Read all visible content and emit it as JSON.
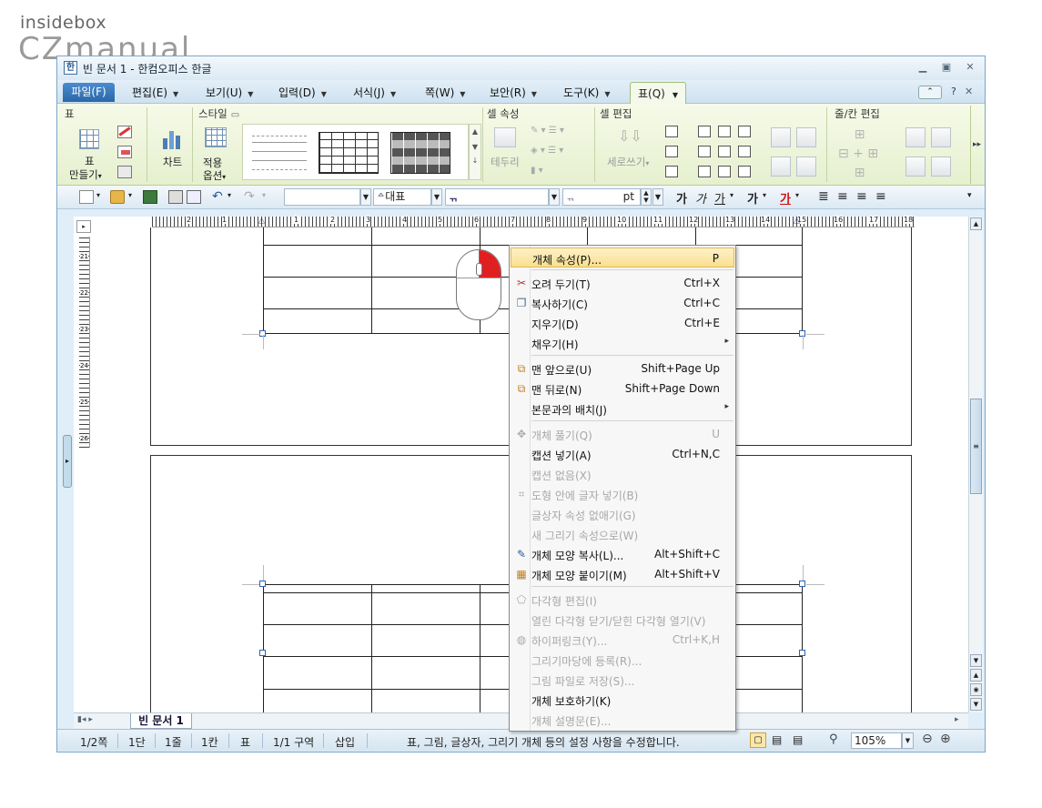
{
  "watermark": {
    "line1": "insidebox",
    "line2": "CZmanual"
  },
  "window": {
    "title": "빈 문서 1 - 한컴오피스 한글",
    "icon_text": "한"
  },
  "menubar": {
    "items": [
      {
        "label": "파일(F)"
      },
      {
        "label": "편집(E)"
      },
      {
        "label": "보기(U)"
      },
      {
        "label": "입력(D)"
      },
      {
        "label": "서식(J)"
      },
      {
        "label": "쪽(W)"
      },
      {
        "label": "보안(R)"
      },
      {
        "label": "도구(K)"
      },
      {
        "label": "표(Q)"
      }
    ]
  },
  "ribbon": {
    "groups": {
      "table": "표",
      "style": "스타일",
      "cell_props": "셀 속성",
      "cell_edit": "셀 편집",
      "row_col_edit": "줄/칸 편집"
    },
    "buttons": {
      "make_table_1": "표",
      "make_table_2": "만들기",
      "chart": "차트",
      "apply_1": "적용",
      "apply_2": "옵션",
      "border": "테두리",
      "vertical_write": "세로쓰기"
    }
  },
  "toolbar": {
    "style_value": "",
    "font_name": "대표",
    "font_size_unit": "pt",
    "format_buttons": [
      "가",
      "가",
      "가",
      "가",
      "가"
    ]
  },
  "document": {
    "tab_label": "빈 문서 1",
    "ruler_numbers": [
      "2",
      "1",
      "1",
      "2",
      "3",
      "4",
      "5",
      "6",
      "7",
      "8",
      "9",
      "10",
      "11",
      "12",
      "13",
      "14",
      "15",
      "16",
      "17",
      "18"
    ],
    "vruler_numbers": [
      "21",
      "22",
      "23",
      "24",
      "25",
      "26"
    ]
  },
  "context_menu": {
    "items": [
      {
        "label": "개체 속성(P)...",
        "shortcut": "P",
        "disabled": false,
        "highlighted": true
      },
      {
        "label": "오려 두기(T)",
        "shortcut": "Ctrl+X",
        "disabled": false,
        "icon": "scissors-icon"
      },
      {
        "label": "복사하기(C)",
        "shortcut": "Ctrl+C",
        "disabled": false,
        "icon": "copy-icon"
      },
      {
        "label": "지우기(D)",
        "shortcut": "Ctrl+E",
        "disabled": false
      },
      {
        "label": "채우기(H)",
        "shortcut": "",
        "disabled": false,
        "submenu": true
      },
      {
        "label": "맨 앞으로(U)",
        "shortcut": "Shift+Page Up",
        "disabled": false,
        "icon": "bring-front-icon"
      },
      {
        "label": "맨 뒤로(N)",
        "shortcut": "Shift+Page Down",
        "disabled": false,
        "icon": "send-back-icon"
      },
      {
        "label": "본문과의 배치(J)",
        "shortcut": "",
        "disabled": false,
        "submenu": true
      },
      {
        "label": "개체 풀기(Q)",
        "shortcut": "U",
        "disabled": true,
        "icon": "ungroup-icon"
      },
      {
        "label": "캡션 넣기(A)",
        "shortcut": "Ctrl+N,C",
        "disabled": false
      },
      {
        "label": "캡션 없음(X)",
        "shortcut": "",
        "disabled": true
      },
      {
        "label": "도형 안에 글자 넣기(B)",
        "shortcut": "",
        "disabled": true,
        "icon": "text-in-shape-icon"
      },
      {
        "label": "글상자 속성 없애기(G)",
        "shortcut": "",
        "disabled": true
      },
      {
        "label": "새 그리기 속성으로(W)",
        "shortcut": "",
        "disabled": true
      },
      {
        "label": "개체 모양 복사(L)...",
        "shortcut": "Alt+Shift+C",
        "disabled": false,
        "icon": "format-copy-icon"
      },
      {
        "label": "개체 모양 붙이기(M)",
        "shortcut": "Alt+Shift+V",
        "disabled": false,
        "icon": "format-paste-icon"
      },
      {
        "label": "다각형 편집(I)",
        "shortcut": "",
        "disabled": true,
        "icon": "polygon-icon"
      },
      {
        "label": "열린 다각형 닫기/닫힌 다각형 열기(V)",
        "shortcut": "",
        "disabled": true
      },
      {
        "label": "하이퍼링크(Y)...",
        "shortcut": "Ctrl+K,H",
        "disabled": true,
        "icon": "hyperlink-icon"
      },
      {
        "label": "그리기마당에 등록(R)...",
        "shortcut": "",
        "disabled": true
      },
      {
        "label": "그림 파일로 저장(S)...",
        "shortcut": "",
        "disabled": true
      },
      {
        "label": "개체 보호하기(K)",
        "shortcut": "",
        "disabled": false
      },
      {
        "label": "개체 설명문(E)...",
        "shortcut": "",
        "disabled": true
      }
    ]
  },
  "statusbar": {
    "page": "1/2쪽",
    "column": "1단",
    "line": "1줄",
    "col": "1칸",
    "mode": "표",
    "section": "1/1 구역",
    "insert": "삽입",
    "message": "표, 그림, 글상자, 그리기 개체 등의 설정 사항을 수정합니다.",
    "zoom": "105%"
  },
  "colors": {
    "accent": "#2b67a8",
    "highlight": "#f9df8e",
    "mouse_click": "#e02020",
    "arrow": "#e02020"
  }
}
